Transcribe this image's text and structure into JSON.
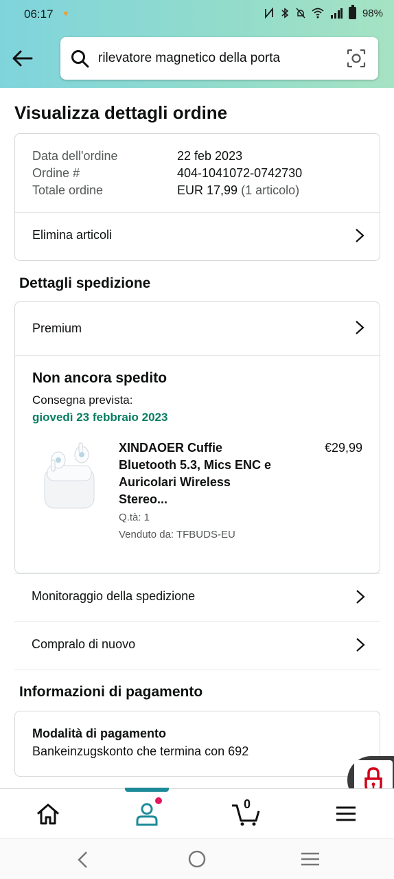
{
  "status_bar": {
    "time": "06:17",
    "battery": "98%"
  },
  "search": {
    "query": "rilevatore magnetico della porta"
  },
  "page": {
    "title": "Visualizza dettagli ordine"
  },
  "order_summary": {
    "date_label": "Data dell'ordine",
    "date_value": "22 feb 2023",
    "order_label": "Ordine #",
    "order_value": "404-1041072-0742730",
    "total_label": "Totale ordine",
    "total_value": "EUR 17,99",
    "total_items": "(1 articolo)",
    "delete_items": "Elimina articoli"
  },
  "shipping": {
    "section_title": "Dettagli spedizione",
    "method": "Premium",
    "status": "Non ancora spedito",
    "expected_label": "Consegna prevista:",
    "expected_date": "giovedì 23 febbraio 2023",
    "product": {
      "title_line1": "XINDAOER Cuffie",
      "title_line2": "Bluetooth 5.3, Mics ENC e",
      "title_line3": "Auricolari Wireless",
      "title_line4": "Stereo...",
      "price": "€29,99",
      "qty": "Q.tà: 1",
      "seller": "Venduto da: TFBUDS-EU",
      "image_icon": "earbuds-case-image"
    },
    "track": "Monitoraggio della spedizione",
    "buy_again": "Compralo di nuovo"
  },
  "payment": {
    "section_title": "Informazioni di pagamento",
    "method_title": "Modalità di pagamento",
    "method_value": "Bankeinzugskonto che termina con 692"
  },
  "bottom_nav": {
    "cart_count": "0",
    "items": [
      "home-icon",
      "account-icon",
      "cart-icon",
      "menu-icon"
    ]
  },
  "colors": {
    "accent": "#1d8a99",
    "green": "#067d62",
    "badge": "#e3175f",
    "lock": "#d0021b"
  }
}
